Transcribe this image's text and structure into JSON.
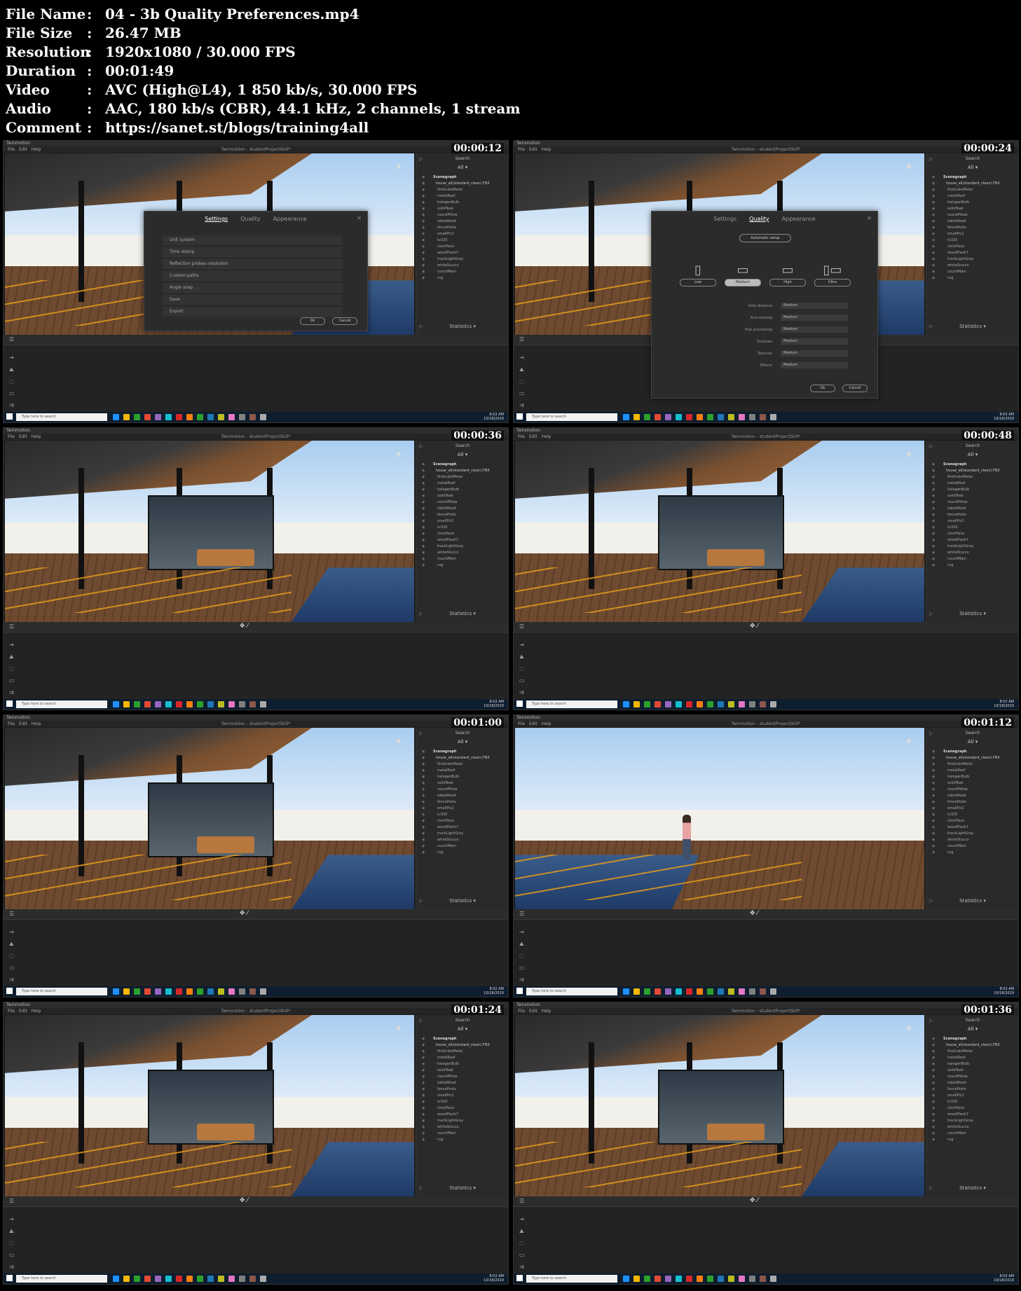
{
  "info": [
    {
      "key": "File Name",
      "sep": ":",
      "value": "04 - 3b Quality Preferences.mp4"
    },
    {
      "key": "File Size",
      "sep": ":",
      "value": "26.47 MB"
    },
    {
      "key": "Resolution",
      "sep": ":",
      "value": "1920x1080 / 30.000 FPS"
    },
    {
      "key": "Duration",
      "sep": ":",
      "value": "00:01:49"
    },
    {
      "key": "Video",
      "sep": ":",
      "value": "AVC (High@L4), 1 850 kb/s, 30.000 FPS"
    },
    {
      "key": "Audio",
      "sep": ":",
      "value": "AAC, 180 kb/s (CBR), 44.1 kHz, 2 channels, 1 stream"
    },
    {
      "key": "Comment",
      "sep": ":",
      "value": "https://sanet.st/blogs/training4all"
    }
  ],
  "app": {
    "name": "Twinmotion",
    "project_title": "Twinmotion - studentProjectSkill*",
    "menu": [
      "File",
      "Edit",
      "Help"
    ]
  },
  "right_panel": {
    "search_label": "Search",
    "filter_label": "All",
    "stats_label": "Statistics",
    "tree_root": "Scenegraph",
    "tree_house": "house_all(standard_clean).FBX",
    "tree_items": [
      "fireGrateMetal",
      "metalRoof",
      "halogenBulb",
      "solidTeak",
      "roundPillow",
      "tableWood",
      "fencePosts",
      "smallPic2",
      "tv320",
      "clockFace",
      "woodPlank7",
      "trackLightGray",
      "whiteStucco",
      "couchMain",
      "rug"
    ]
  },
  "taskbar": {
    "search_placeholder": "Type here to search",
    "time": "8:02 AM",
    "date": "10/18/2019"
  },
  "tiles": [
    {
      "timecode": "00:00:12",
      "scene": "settings"
    },
    {
      "timecode": "00:00:24",
      "scene": "quality"
    },
    {
      "timecode": "00:00:36",
      "scene": "exterior"
    },
    {
      "timecode": "00:00:48",
      "scene": "exterior"
    },
    {
      "timecode": "00:01:00",
      "scene": "exterior"
    },
    {
      "timecode": "00:01:12",
      "scene": "pool"
    },
    {
      "timecode": "00:01:24",
      "scene": "interior"
    },
    {
      "timecode": "00:01:36",
      "scene": "interior"
    }
  ],
  "settings_dialog": {
    "tabs": [
      "Settings",
      "Quality",
      "Appearance"
    ],
    "items": [
      "Unit system",
      "Time stamp",
      "Reflection probes resolution",
      "Custom paths",
      "Angle snap",
      "Save",
      "Export"
    ],
    "ok": "Ok",
    "cancel": "Cancel"
  },
  "quality_dialog": {
    "automatic_setup": "Automatic setup",
    "presets": [
      {
        "label": "Low",
        "icon": "phone-icon"
      },
      {
        "label": "Medium",
        "icon": "laptop-icon",
        "selected": true
      },
      {
        "label": "High",
        "icon": "monitor-icon"
      },
      {
        "label": "Ultra",
        "icon": "workstation-icon"
      }
    ],
    "options": [
      {
        "label": "View distance",
        "value": "Medium"
      },
      {
        "label": "Anti-aliasing",
        "value": "Medium"
      },
      {
        "label": "Post-processing",
        "value": "Medium"
      },
      {
        "label": "Shadows",
        "value": "Medium"
      },
      {
        "label": "Textures",
        "value": "Medium"
      },
      {
        "label": "Effects",
        "value": "Medium"
      }
    ]
  },
  "colors": {
    "accent_orange": "#e49a1c",
    "panel_bg": "#2a2a2a",
    "taskbar_bg": "#0f1e2e"
  }
}
